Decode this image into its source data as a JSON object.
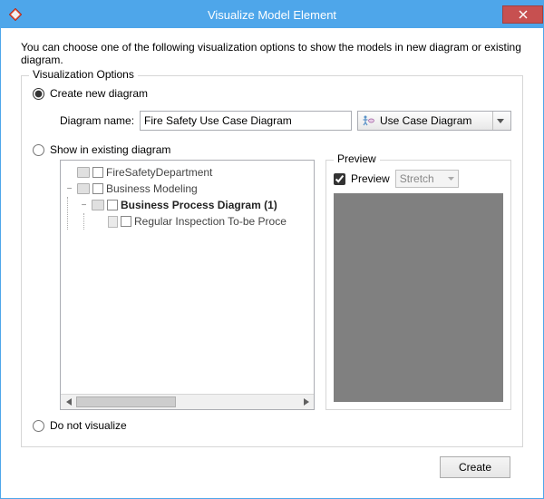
{
  "window": {
    "title": "Visualize Model Element",
    "close_icon": "close-icon"
  },
  "instruction": "You can choose one of the following visualization options to show the models in new diagram or existing diagram.",
  "options": {
    "legend": "Visualization Options",
    "create_label": "Create new diagram",
    "existing_label": "Show in existing diagram",
    "none_label": "Do not visualize",
    "selected": "create"
  },
  "diagram": {
    "name_label": "Diagram name:",
    "name_value": "Fire Safety Use Case Diagram",
    "type_label": "Use Case Diagram"
  },
  "tree": {
    "items": [
      {
        "level": 0,
        "icon": "folder",
        "checkbox": true,
        "label": "FireSafetyDepartment",
        "twisty": ""
      },
      {
        "level": 0,
        "icon": "folder",
        "checkbox": true,
        "label": "Business Modeling",
        "twisty": "−"
      },
      {
        "level": 1,
        "icon": "folder",
        "checkbox": true,
        "label": "Business Process Diagram (1)",
        "twisty": "−",
        "bold": true
      },
      {
        "level": 2,
        "icon": "doc",
        "checkbox": true,
        "label": "Regular Inspection To-be Proce",
        "twisty": ""
      }
    ]
  },
  "preview": {
    "legend": "Preview",
    "checkbox_label": "Preview",
    "checked": true,
    "mode": "Stretch"
  },
  "footer": {
    "create_label": "Create"
  }
}
